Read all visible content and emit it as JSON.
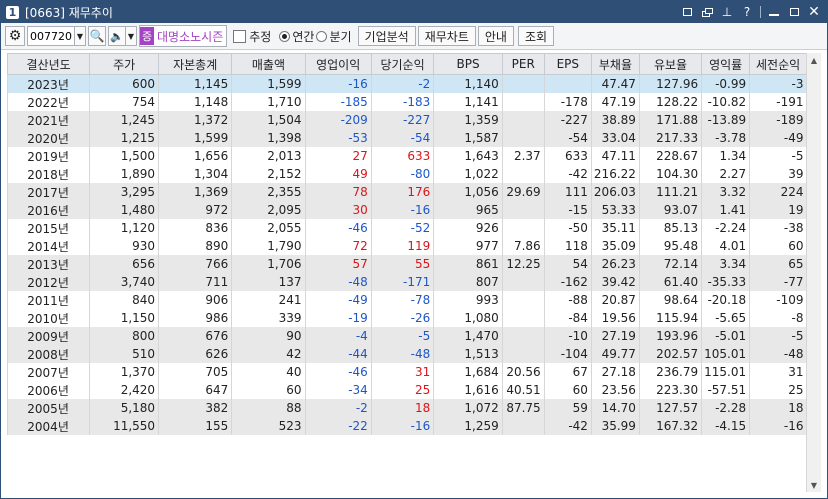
{
  "window": {
    "number": "1",
    "title": "[0663] 재무추이"
  },
  "toolbar": {
    "stock_code": "007720",
    "stock_tag": "증",
    "stock_name": "대명소노시즌",
    "estimate_label": "추정",
    "annual_label": "연간",
    "quarter_label": "분기",
    "btn_company_analysis": "기업분석",
    "btn_financial_chart": "재무차트",
    "btn_guide": "안내",
    "btn_query": "조회"
  },
  "table": {
    "headers": [
      "결산년도",
      "주가",
      "자본총계",
      "매출액",
      "영업이익",
      "당기순익",
      "BPS",
      "PER",
      "EPS",
      "부채율",
      "유보율",
      "영익률",
      "세전순익"
    ],
    "rows": [
      [
        "2023년",
        "600",
        "1,145",
        "1,599",
        "-16",
        "-2",
        "1,140",
        "",
        "",
        "47.47",
        "127.96",
        "-0.99",
        "-3"
      ],
      [
        "2022년",
        "754",
        "1,148",
        "1,710",
        "-185",
        "-183",
        "1,141",
        "",
        "-178",
        "47.19",
        "128.22",
        "-10.82",
        "-191"
      ],
      [
        "2021년",
        "1,245",
        "1,372",
        "1,504",
        "-209",
        "-227",
        "1,359",
        "",
        "-227",
        "38.89",
        "171.88",
        "-13.89",
        "-189"
      ],
      [
        "2020년",
        "1,215",
        "1,599",
        "1,398",
        "-53",
        "-54",
        "1,587",
        "",
        "-54",
        "33.04",
        "217.33",
        "-3.78",
        "-49"
      ],
      [
        "2019년",
        "1,500",
        "1,656",
        "2,013",
        "27",
        "633",
        "1,643",
        "2.37",
        "633",
        "47.11",
        "228.67",
        "1.34",
        "-5"
      ],
      [
        "2018년",
        "1,890",
        "1,304",
        "2,152",
        "49",
        "-80",
        "1,022",
        "",
        "-42",
        "216.22",
        "104.30",
        "2.27",
        "39"
      ],
      [
        "2017년",
        "3,295",
        "1,369",
        "2,355",
        "78",
        "176",
        "1,056",
        "29.69",
        "111",
        "206.03",
        "111.21",
        "3.32",
        "224"
      ],
      [
        "2016년",
        "1,480",
        "972",
        "2,095",
        "30",
        "-16",
        "965",
        "",
        "-15",
        "53.33",
        "93.07",
        "1.41",
        "19"
      ],
      [
        "2015년",
        "1,120",
        "836",
        "2,055",
        "-46",
        "-52",
        "926",
        "",
        "-50",
        "35.11",
        "85.13",
        "-2.24",
        "-38"
      ],
      [
        "2014년",
        "930",
        "890",
        "1,790",
        "72",
        "119",
        "977",
        "7.86",
        "118",
        "35.09",
        "95.48",
        "4.01",
        "60"
      ],
      [
        "2013년",
        "656",
        "766",
        "1,706",
        "57",
        "55",
        "861",
        "12.25",
        "54",
        "26.23",
        "72.14",
        "3.34",
        "65"
      ],
      [
        "2012년",
        "3,740",
        "711",
        "137",
        "-48",
        "-171",
        "807",
        "",
        "-162",
        "39.42",
        "61.40",
        "-35.33",
        "-77"
      ],
      [
        "2011년",
        "840",
        "906",
        "241",
        "-49",
        "-78",
        "993",
        "",
        "-88",
        "20.87",
        "98.64",
        "-20.18",
        "-109"
      ],
      [
        "2010년",
        "1,150",
        "986",
        "339",
        "-19",
        "-26",
        "1,080",
        "",
        "-84",
        "19.56",
        "115.94",
        "-5.65",
        "-8"
      ],
      [
        "2009년",
        "800",
        "676",
        "90",
        "-4",
        "-5",
        "1,470",
        "",
        "-10",
        "27.19",
        "193.96",
        "-5.01",
        "-5"
      ],
      [
        "2008년",
        "510",
        "626",
        "42",
        "-44",
        "-48",
        "1,513",
        "",
        "-104",
        "49.77",
        "202.57",
        "105.01",
        "-48"
      ],
      [
        "2007년",
        "1,370",
        "705",
        "40",
        "-46",
        "31",
        "1,684",
        "20.56",
        "67",
        "27.18",
        "236.79",
        "115.01",
        "31"
      ],
      [
        "2006년",
        "2,420",
        "647",
        "60",
        "-34",
        "25",
        "1,616",
        "40.51",
        "60",
        "23.56",
        "223.30",
        "-57.51",
        "25"
      ],
      [
        "2005년",
        "5,180",
        "382",
        "88",
        "-2",
        "18",
        "1,072",
        "87.75",
        "59",
        "14.70",
        "127.57",
        "-2.28",
        "18"
      ],
      [
        "2004년",
        "11,550",
        "155",
        "523",
        "-22",
        "-16",
        "1,259",
        "",
        "-42",
        "35.99",
        "167.32",
        "-4.15",
        "-16"
      ]
    ]
  },
  "colors": {
    "title_bg": "#2f4f77",
    "negative": "#1d57c7",
    "positive": "#d9151a",
    "selected_row": "#cfe6f5",
    "stock_tag": "#a442c4"
  }
}
